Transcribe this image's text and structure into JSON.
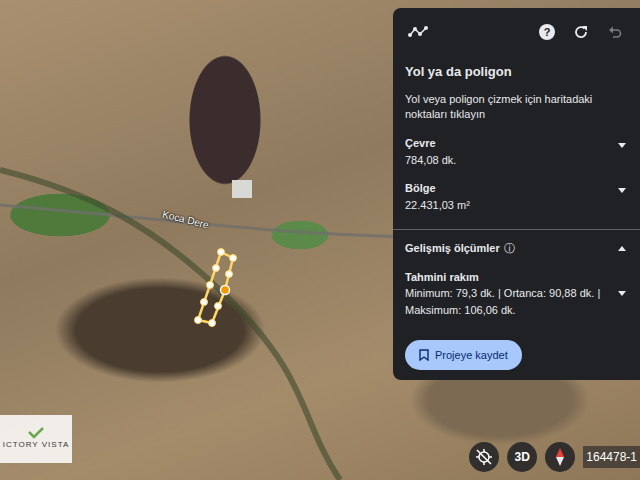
{
  "panel": {
    "title": "Yol ya da poligon",
    "instruction": "Yol veya poligon çizmek için haritadaki noktaları tıklayın",
    "toolbar": {
      "help": "?",
      "undo_disabled": true
    },
    "measurements": [
      {
        "label": "Çevre",
        "value": "784,08 dk.",
        "expanded": false
      },
      {
        "label": "Bölge",
        "value": "22.431,03 m²",
        "expanded": false
      }
    ],
    "advanced": {
      "title": "Gelişmiş ölçümler",
      "info": "ⓘ",
      "expanded": true,
      "elevation_label": "Tahmini rakım",
      "elevation_value": "Minimum: 79,3 dk. | Ortanca: 90,88 dk. | Maksimum: 106,06 dk.",
      "elevation_expanded": false
    },
    "save_button": "Projeye kaydet"
  },
  "map": {
    "labels": [
      "Koca Dere"
    ],
    "watermark": "ICTORY VISTA",
    "scale_text": "164478-1"
  },
  "controls": {
    "view_3d": "3D"
  }
}
